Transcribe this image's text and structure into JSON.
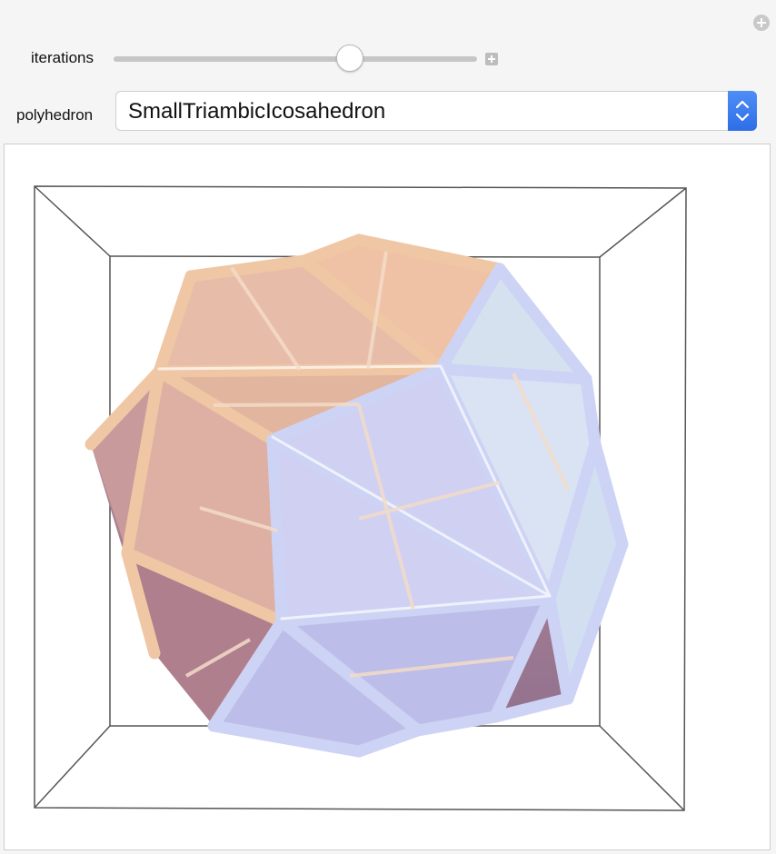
{
  "controls": {
    "iterations": {
      "label": "iterations",
      "value_fraction": 0.65
    },
    "polyhedron": {
      "label": "polyhedron",
      "selected": "SmallTriambicIcosahedron"
    }
  },
  "icons": {
    "corner": "plus-circle-icon",
    "slider_expand": "plus-square-icon",
    "select_stepper": "chevron-up-down-icon"
  },
  "colors": {
    "accent": "#2d6ee6",
    "frame_line": "#555555",
    "tube_warm": "#f2b88e",
    "tube_cool": "#c8cdf0",
    "face_warm": "#e2b5a8",
    "face_cool": "#c9c8ee"
  }
}
